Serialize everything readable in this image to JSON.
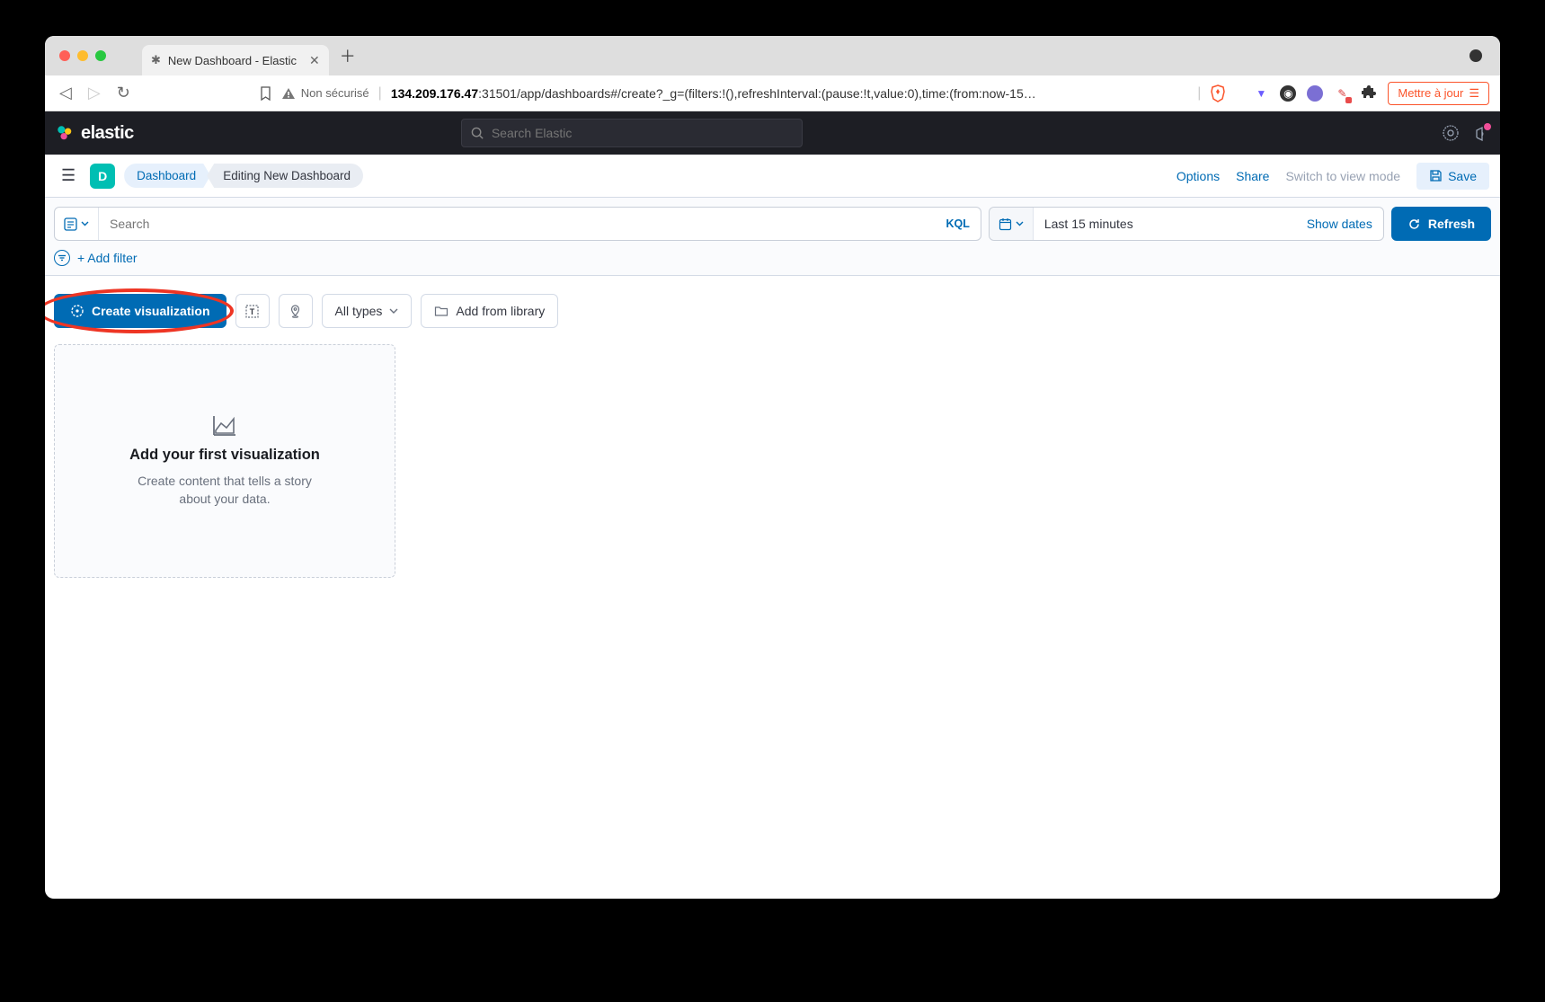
{
  "browser": {
    "tab_title": "New Dashboard - Elastic",
    "security_label": "Non sécurisé",
    "url_host": "134.209.176.47",
    "url_path": ":31501/app/dashboards#/create?_g=(filters:!(),refreshInterval:(pause:!t,value:0),time:(from:now-15…",
    "update_button": "Mettre à jour"
  },
  "header": {
    "brand_text": "elastic",
    "search_placeholder": "Search Elastic"
  },
  "breadcrumb": {
    "space_letter": "D",
    "items": [
      "Dashboard",
      "Editing New Dashboard"
    ],
    "actions": {
      "options": "Options",
      "share": "Share",
      "switch_view": "Switch to view mode",
      "save": "Save"
    }
  },
  "query": {
    "placeholder": "Search",
    "language": "KQL",
    "time_range": "Last 15 minutes",
    "show_dates": "Show dates",
    "refresh": "Refresh",
    "add_filter": "+ Add filter"
  },
  "toolbar": {
    "create_visualization": "Create visualization",
    "all_types": "All types",
    "add_from_library": "Add from library"
  },
  "placeholder_panel": {
    "title": "Add your first visualization",
    "text": "Create content that tells a story about your data."
  }
}
